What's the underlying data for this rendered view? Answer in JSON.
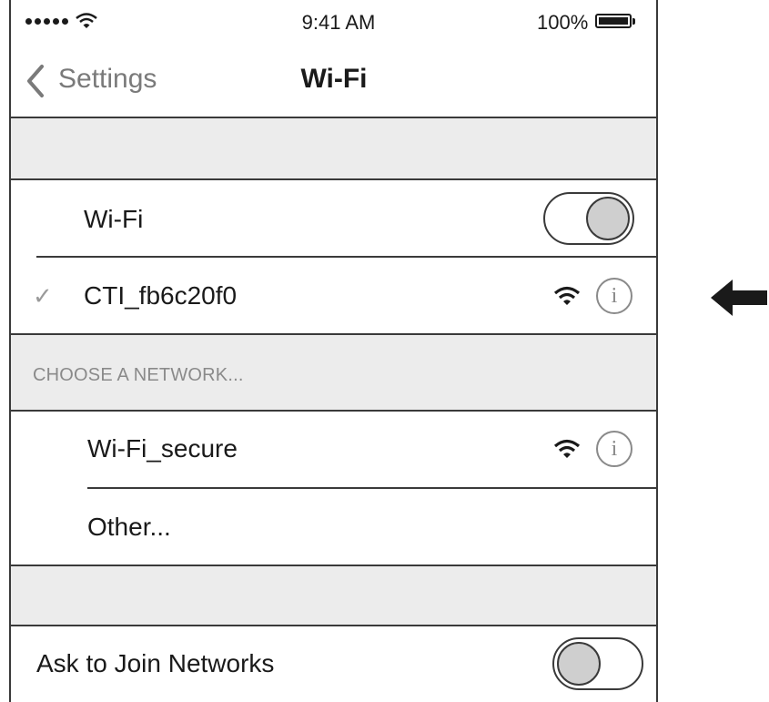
{
  "status_bar": {
    "time": "9:41 AM",
    "battery_percent": "100%"
  },
  "nav": {
    "back_label": "Settings",
    "title": "Wi-Fi"
  },
  "wifi_toggle": {
    "label": "Wi-Fi",
    "on": true
  },
  "connected_network": {
    "name": "CTI_fb6c20f0",
    "icons": [
      "checkmark-icon",
      "wifi-signal-icon",
      "info-icon"
    ]
  },
  "choose_section": {
    "header": "CHOOSE A NETWORK..."
  },
  "networks": [
    {
      "name": "Wi-Fi_secure"
    },
    {
      "name": "Other..."
    }
  ],
  "ask_to_join": {
    "label": "Ask to Join Networks",
    "on": false
  },
  "colors": {
    "section_gray": "#ececec",
    "line": "#3a3a3a",
    "secondary_text": "#7a7a7a"
  }
}
